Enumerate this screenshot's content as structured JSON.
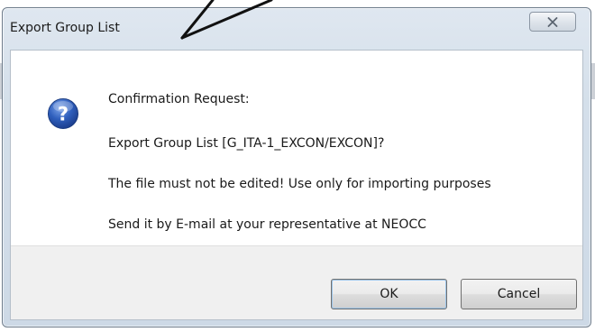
{
  "window": {
    "title": "Export Group List",
    "close_icon": "close-icon"
  },
  "message": {
    "icon": "question-icon",
    "heading": "Confirmation Request:",
    "line_2": "Export Group List [G_ITA-1_EXCON/EXCON]?",
    "line_3": "The file must not be edited! Use only for importing purposes",
    "line_4": "Send it by E-mail at your representative at NEOCC"
  },
  "buttons": {
    "ok_label": "OK",
    "cancel_label": "Cancel"
  },
  "colors": {
    "icon_blue": "#2a5cb8",
    "frame": "#cdd9e6",
    "button_bar": "#f0f0f0"
  }
}
